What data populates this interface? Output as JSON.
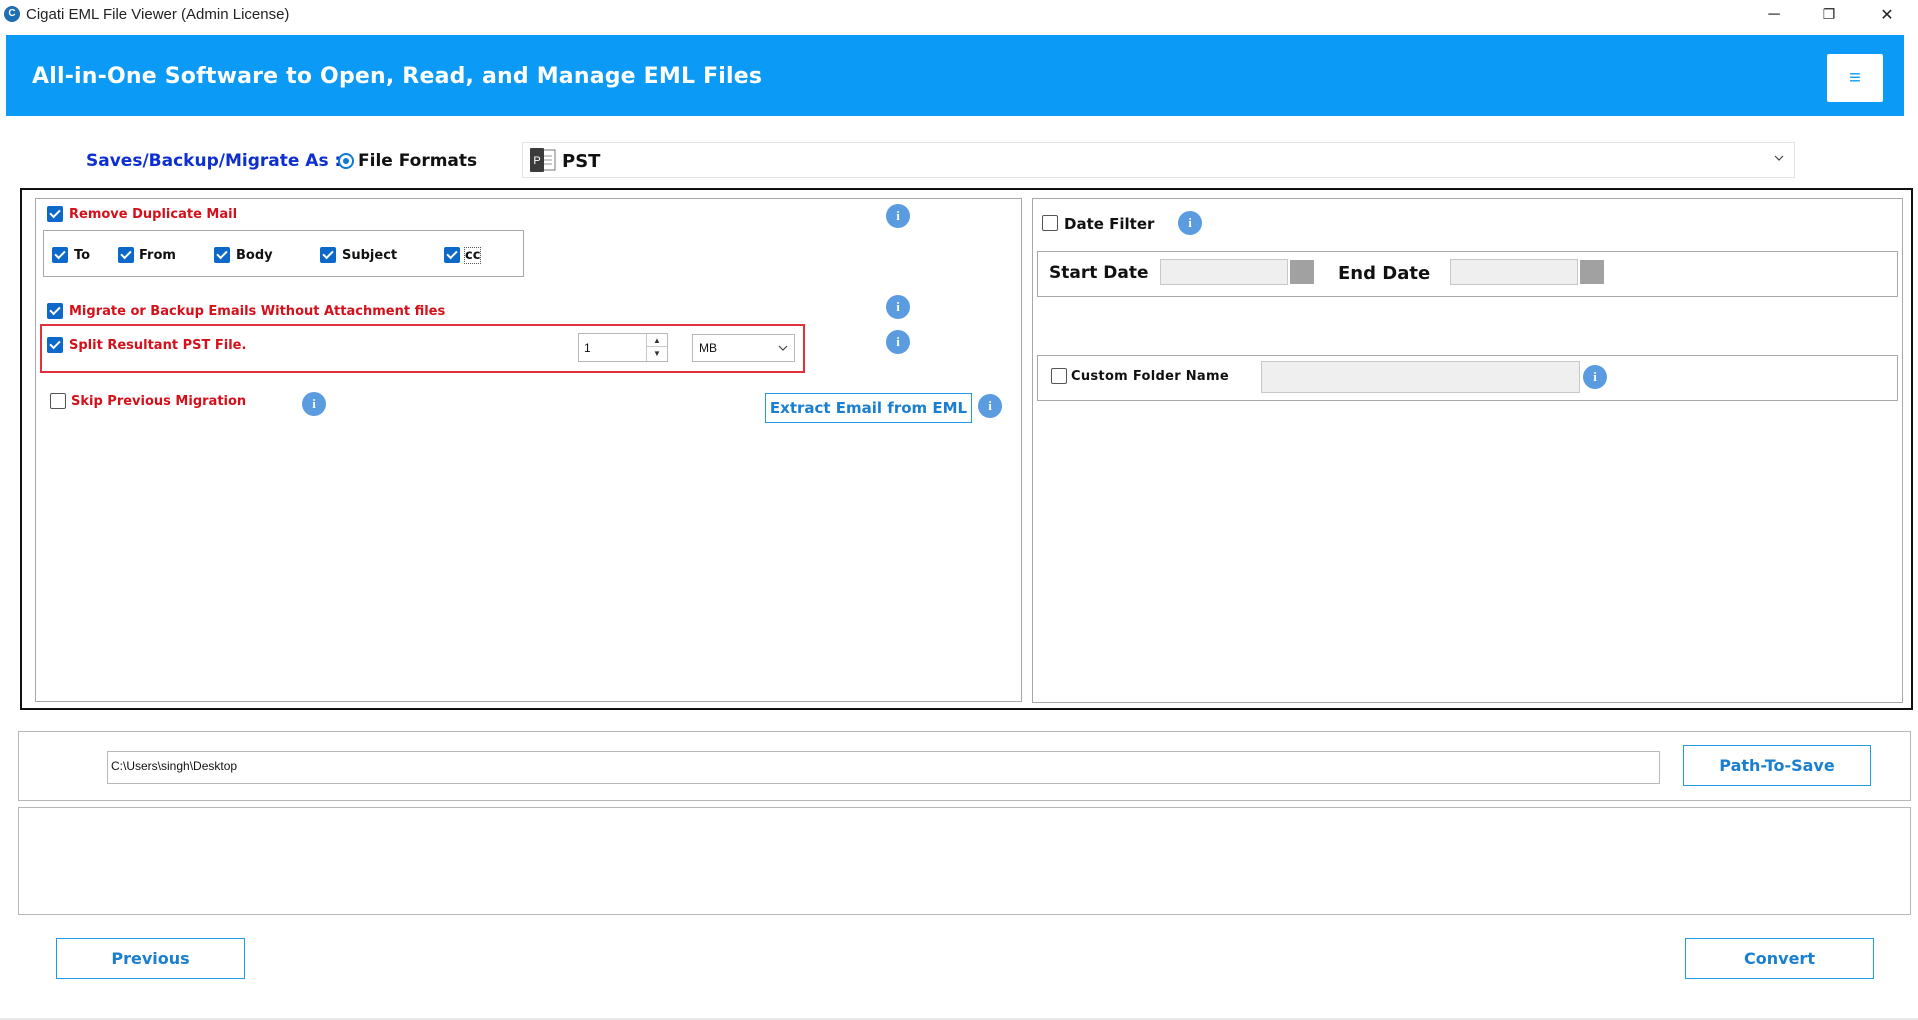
{
  "window": {
    "title": "Cigati EML File Viewer (Admin License)",
    "app_icon_letter": "C",
    "controls": {
      "minimize": "─",
      "maximize": "❐",
      "close": "✕"
    }
  },
  "banner": {
    "title": "All-in-One Software to Open, Read, and Manage EML Files",
    "menu_icon": "≡",
    "color": "#0c9af7"
  },
  "format": {
    "saves_label": "Saves/Backup/Migrate As :",
    "radio_label": "File Formats",
    "selected": "PST",
    "icon_letter": "P"
  },
  "left_options": {
    "remove_duplicate": {
      "label": "Remove Duplicate Mail",
      "checked": true
    },
    "duplicate_fields": [
      {
        "label": "To",
        "checked": true
      },
      {
        "label": "From",
        "checked": true
      },
      {
        "label": "Body",
        "checked": true
      },
      {
        "label": "Subject",
        "checked": true
      },
      {
        "label": "cc",
        "checked": true
      }
    ],
    "without_attachments": {
      "label": "Migrate or Backup Emails Without Attachment files",
      "checked": true
    },
    "split_pst": {
      "label": "Split Resultant PST File.",
      "checked": true,
      "size_value": "1",
      "unit": "MB"
    },
    "skip_previous": {
      "label": "Skip Previous Migration",
      "checked": false
    },
    "extract_button": "Extract Email from EML"
  },
  "right_options": {
    "date_filter": {
      "label": "Date Filter",
      "checked": false
    },
    "start_date_label": "Start Date",
    "end_date_label": "End Date",
    "custom_folder": {
      "label": "Custom Folder Name",
      "checked": false
    }
  },
  "info_glyph": "i",
  "path": {
    "value": "C:\\Users\\singh\\Desktop",
    "button": "Path-To-Save"
  },
  "nav": {
    "previous": "Previous",
    "convert": "Convert"
  },
  "colors": {
    "accent": "#1a7fd0",
    "warning_label": "#d4101b",
    "highlight_border": "#e0323a",
    "checkbox": "#0c68c9"
  }
}
